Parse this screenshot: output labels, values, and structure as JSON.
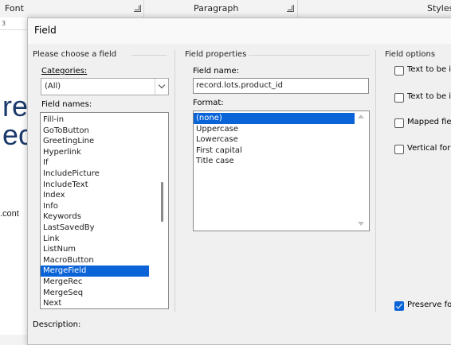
{
  "ribbon": {
    "groups": [
      "Font",
      "Paragraph",
      "Styles"
    ]
  },
  "document": {
    "ruler_mark": "3",
    "fragment_big_1": "re",
    "fragment_big_2": "ec",
    "fragment_small": ".cont"
  },
  "dialog": {
    "title": "Field",
    "choose_field": {
      "header": "Please choose a field",
      "categories_label": "Categories:",
      "categories_value": "(All)",
      "field_names_label": "Field names:",
      "field_names": [
        "Fill-in",
        "GoToButton",
        "GreetingLine",
        "Hyperlink",
        "If",
        "IncludePicture",
        "IncludeText",
        "Index",
        "Info",
        "Keywords",
        "LastSavedBy",
        "Link",
        "ListNum",
        "MacroButton",
        "MergeField",
        "MergeRec",
        "MergeSeq",
        "Next"
      ],
      "selected_field": "MergeField"
    },
    "field_properties": {
      "header": "Field properties",
      "field_name_label": "Field name:",
      "field_name_value": "record.lots.product_id",
      "format_label": "Format:",
      "formats": [
        "(none)",
        "Uppercase",
        "Lowercase",
        "First capital",
        "Title case"
      ],
      "selected_format": "(none)"
    },
    "field_options": {
      "header": "Field options",
      "options": [
        {
          "label": "Text to be in",
          "checked": false
        },
        {
          "label": "Text to be in",
          "checked": false
        },
        {
          "label": "Mapped fiel",
          "checked": false
        },
        {
          "label": "Vertical form",
          "checked": false
        }
      ],
      "preserve_label": "Preserve for",
      "preserve_checked": true
    },
    "description_label": "Description:"
  },
  "colors": {
    "selection": "#0a64d8",
    "doc_text": "#1b3a6b"
  }
}
